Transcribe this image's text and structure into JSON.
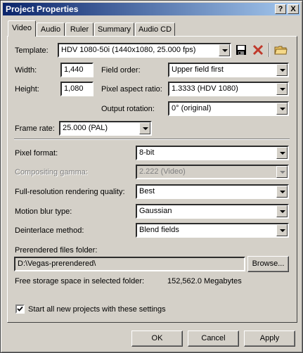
{
  "window": {
    "title": "Project Properties",
    "help_btn": "?",
    "close_btn": "X"
  },
  "tabs": [
    {
      "label": "Video",
      "active": true
    },
    {
      "label": "Audio"
    },
    {
      "label": "Ruler"
    },
    {
      "label": "Summary"
    },
    {
      "label": "Audio CD"
    }
  ],
  "video": {
    "template_label": "Template:",
    "template_value": "HDV 1080-50i (1440x1080, 25.000 fps)",
    "width_label": "Width:",
    "width_value": "1,440",
    "height_label": "Height:",
    "height_value": "1,080",
    "field_order_label": "Field order:",
    "field_order_value": "Upper field first",
    "pixel_aspect_label": "Pixel aspect ratio:",
    "pixel_aspect_value": "1.3333 (HDV 1080)",
    "output_rotation_label": "Output rotation:",
    "output_rotation_value": "0° (original)",
    "frame_rate_label": "Frame rate:",
    "frame_rate_value": "25.000 (PAL)",
    "pixel_format_label": "Pixel format:",
    "pixel_format_value": "8-bit",
    "compositing_gamma_label": "Compositing gamma:",
    "compositing_gamma_value": "2.222 (Video)",
    "render_quality_label": "Full-resolution rendering quality:",
    "render_quality_value": "Best",
    "motion_blur_label": "Motion blur type:",
    "motion_blur_value": "Gaussian",
    "deinterlace_label": "Deinterlace method:",
    "deinterlace_value": "Blend fields",
    "prerender_folder_label": "Prerendered files folder:",
    "prerender_folder_value": "D:\\Vegas-prerendered\\",
    "browse_label": "Browse...",
    "free_space_label": "Free storage space in selected folder:",
    "free_space_value": "152,562.0 Megabytes",
    "start_all_label": "Start all new projects with these settings",
    "start_all_checked": true
  },
  "buttons": {
    "ok": "OK",
    "cancel": "Cancel",
    "apply": "Apply"
  }
}
